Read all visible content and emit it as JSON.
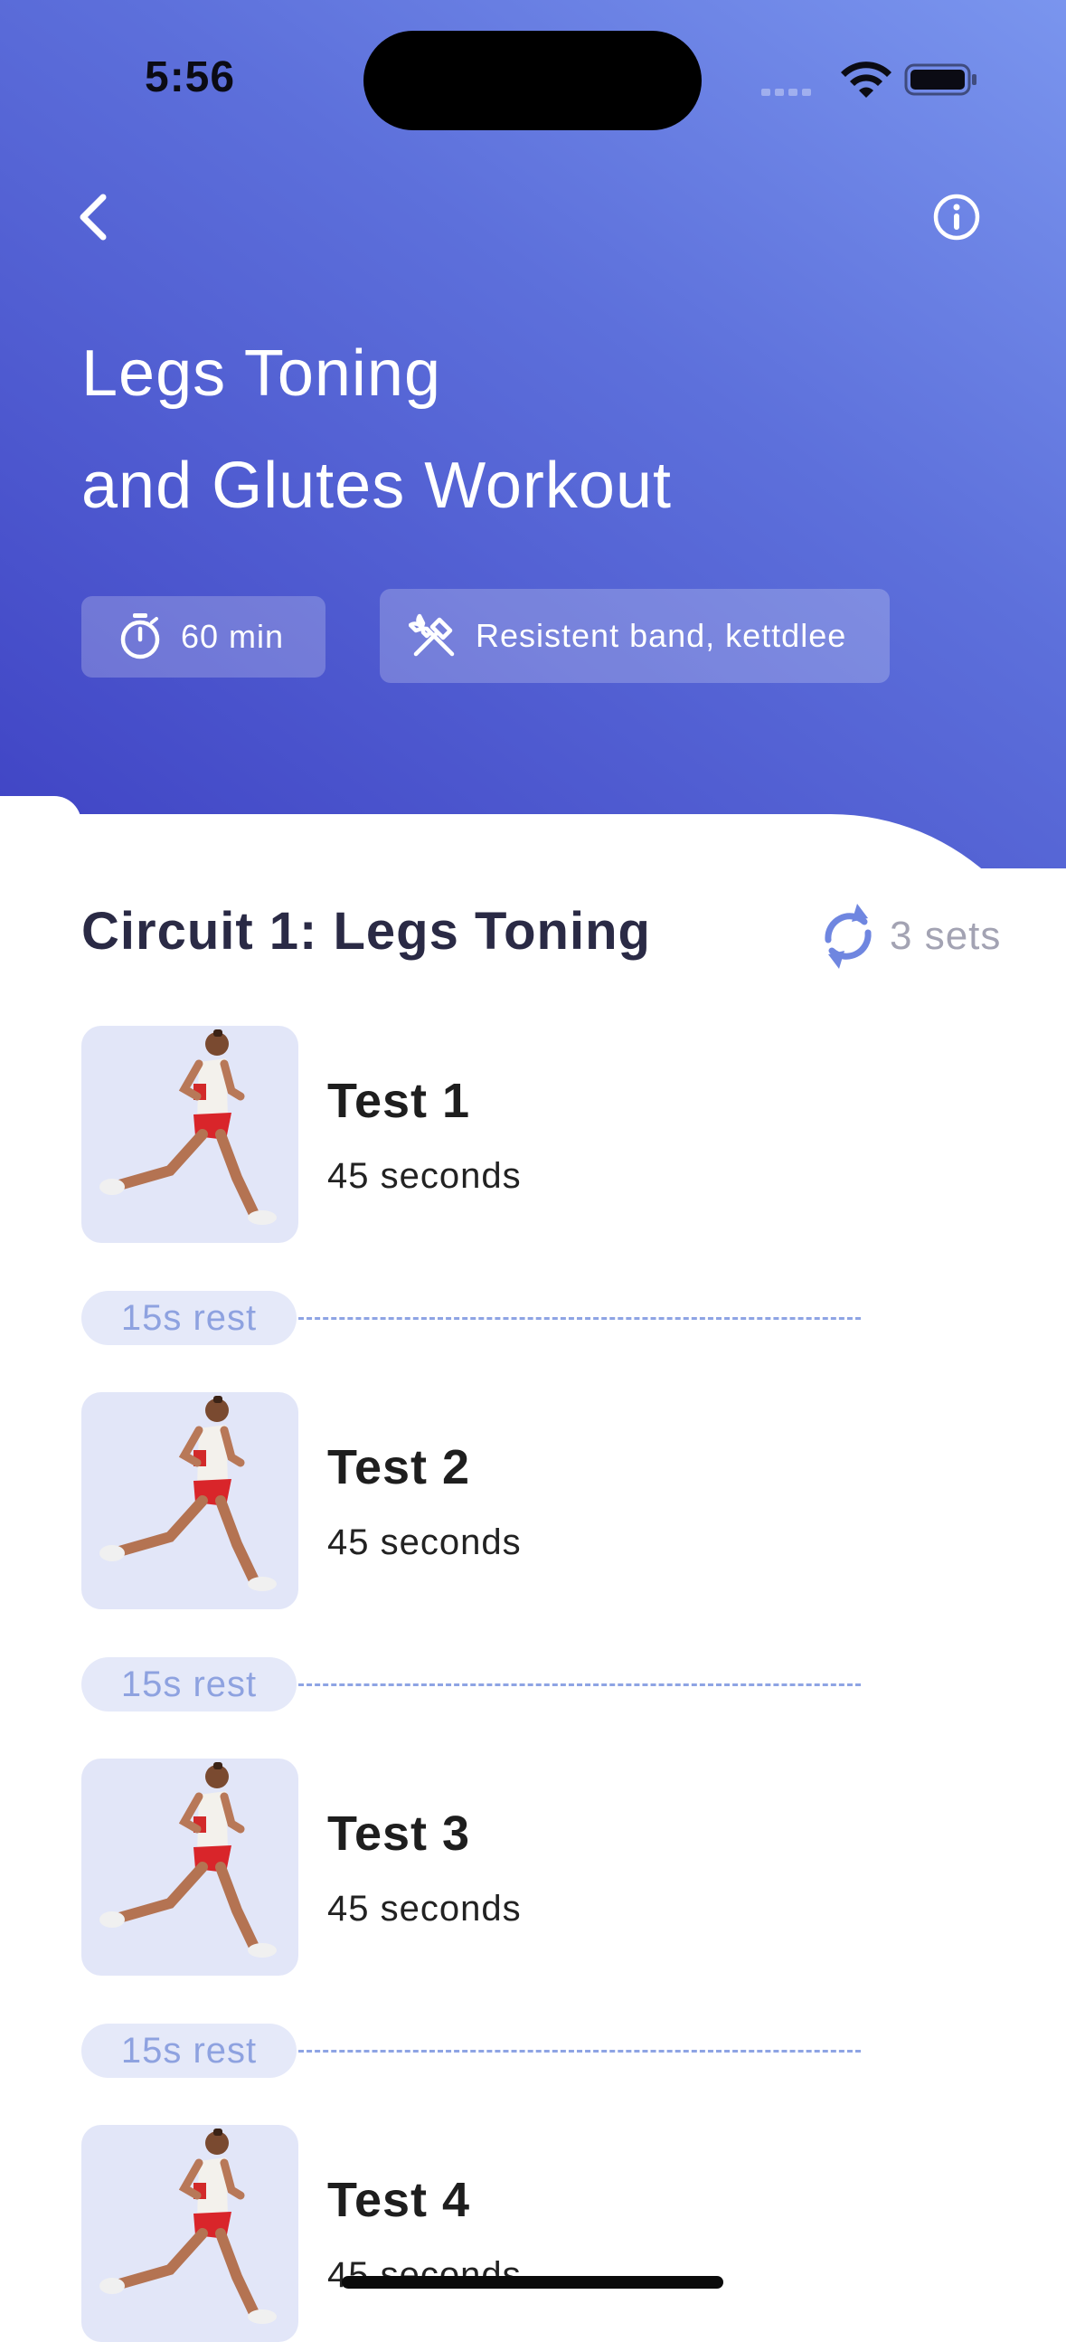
{
  "status_bar": {
    "time": "5:56"
  },
  "header": {
    "title_line1": "Legs Toning",
    "title_line2": "and Glutes Workout",
    "duration": "60 min",
    "equipment": "Resistent band, kettdlee"
  },
  "circuit": {
    "title": "Circuit 1: Legs Toning",
    "sets": "3 sets",
    "exercises": [
      {
        "name": "Test 1",
        "duration": "45 seconds"
      },
      {
        "name": "Test 2",
        "duration": "45 seconds"
      },
      {
        "name": "Test 3",
        "duration": "45 seconds"
      },
      {
        "name": "Test 4",
        "duration": "45 seconds"
      }
    ],
    "rests": [
      "15s rest",
      "15s rest",
      "15s rest"
    ]
  },
  "colors": {
    "header_gradient_start": "#7a95ee",
    "header_gradient_end": "#3f43c4",
    "accent": "#6f86e0",
    "title_text": "#2a2a45"
  },
  "icons": {
    "back": "chevron-left-icon",
    "info": "info-icon",
    "duration": "stopwatch-icon",
    "equipment": "hammer-wrench-icon",
    "sets": "refresh-icon",
    "exercise_image": "runner-photo"
  }
}
